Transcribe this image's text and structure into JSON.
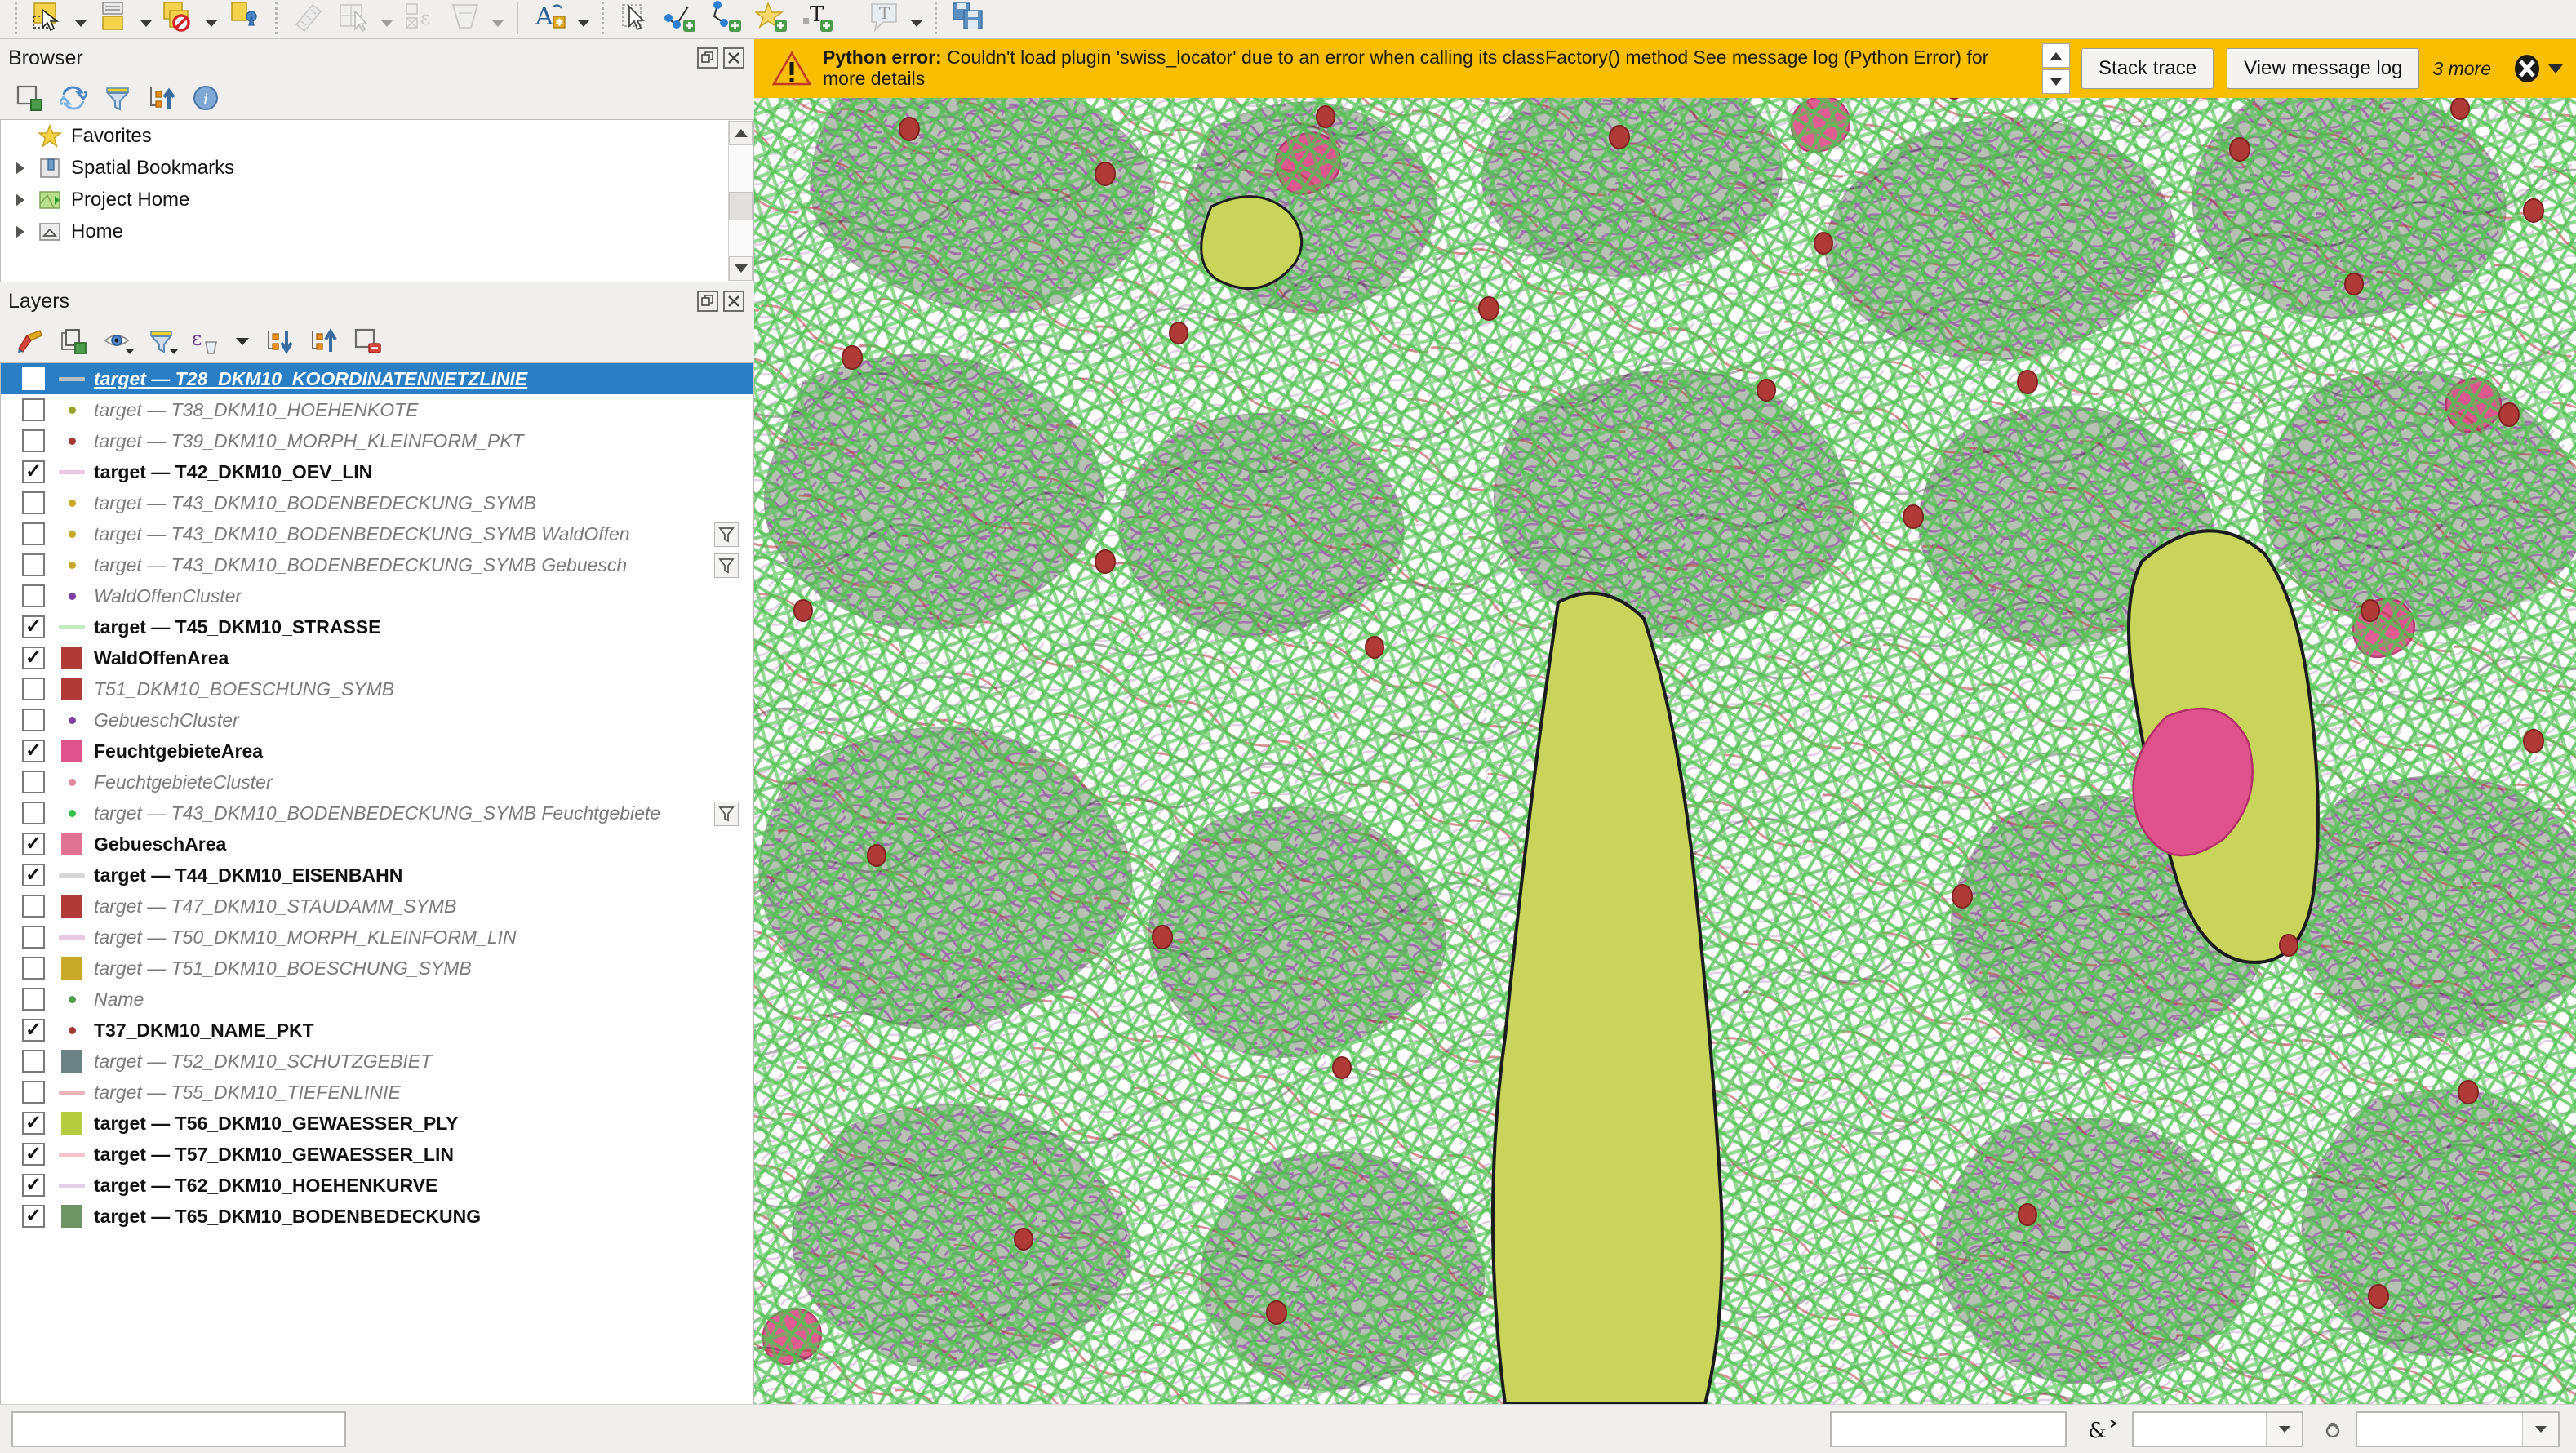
{
  "toolbar": {
    "items": [
      {
        "name": "select-features-tool",
        "icon": "select-rect-icon"
      },
      {
        "name": "select-features-dropdown",
        "icon": "chevron-down-icon"
      },
      {
        "name": "deselect-features-tool",
        "icon": "deselect-icon"
      },
      {
        "name": "deselect-dropdown",
        "icon": "chevron-down-icon"
      },
      {
        "name": "select-by-value-tool",
        "icon": "select-value-icon"
      },
      {
        "name": "select-by-value-dropdown",
        "icon": "chevron-down-icon"
      },
      {
        "name": "select-by-location-tool",
        "icon": "select-location-icon"
      },
      {
        "name": "measure-line-tool",
        "icon": "measure-line-icon"
      },
      {
        "name": "measure-area-tool",
        "icon": "measure-area-icon"
      },
      {
        "name": "measure-dropdown",
        "icon": "chevron-down-icon"
      },
      {
        "name": "statistical-summary-tool",
        "icon": "statistics-icon"
      },
      {
        "name": "map-tips-tool",
        "icon": "map-tips-icon"
      },
      {
        "name": "map-tips-dropdown",
        "icon": "chevron-down-icon"
      },
      {
        "name": "text-annotation-tool",
        "icon": "text-annotation-icon"
      },
      {
        "name": "text-annotation-dropdown",
        "icon": "chevron-down-icon"
      },
      {
        "name": "pan-map-tool",
        "icon": "pan-hand-icon"
      },
      {
        "name": "edit-vertex-tool",
        "icon": "vertex-tool-icon"
      },
      {
        "name": "add-line-feature-tool",
        "icon": "add-line-icon"
      },
      {
        "name": "add-point-feature-tool",
        "icon": "add-point-icon"
      },
      {
        "name": "add-polygon-feature-tool",
        "icon": "add-polygon-icon"
      },
      {
        "name": "add-label-tool",
        "icon": "add-label-icon"
      },
      {
        "name": "label-toolbar-tool",
        "icon": "label-balloon-icon"
      },
      {
        "name": "label-toolbar-dropdown",
        "icon": "chevron-down-icon"
      },
      {
        "name": "save-layer-edits-tool",
        "icon": "save-layer-icon"
      }
    ]
  },
  "browser": {
    "title": "Browser",
    "tools": [
      {
        "name": "add-selected-layers-button",
        "icon": "add-layer-icon"
      },
      {
        "name": "refresh-button",
        "icon": "refresh-icon"
      },
      {
        "name": "filter-browser-button",
        "icon": "filter-icon"
      },
      {
        "name": "collapse-all-button",
        "icon": "collapse-all-icon"
      },
      {
        "name": "enable-properties-widget-button",
        "icon": "info-icon"
      }
    ],
    "panel_buttons": [
      {
        "name": "undock-browser-button",
        "icon": "float-icon"
      },
      {
        "name": "close-browser-button",
        "icon": "close-icon"
      }
    ],
    "tree": [
      {
        "label": "Favorites",
        "icon": "star-icon",
        "expandable": false
      },
      {
        "label": "Spatial Bookmarks",
        "icon": "bookmarks-icon",
        "expandable": true
      },
      {
        "label": "Project Home",
        "icon": "project-home-icon",
        "expandable": true
      },
      {
        "label": "Home",
        "icon": "home-icon",
        "expandable": true
      }
    ]
  },
  "layers": {
    "title": "Layers",
    "panel_buttons": [
      {
        "name": "undock-layers-button",
        "icon": "float-icon"
      },
      {
        "name": "close-layers-button",
        "icon": "close-icon"
      }
    ],
    "tools": [
      {
        "name": "open-layer-styling-panel-button",
        "icon": "paintbrush-icon"
      },
      {
        "name": "add-group-button",
        "icon": "add-group-icon"
      },
      {
        "name": "manage-map-themes-button",
        "icon": "eye-icon",
        "has_dropdown": true
      },
      {
        "name": "filter-legend-button",
        "icon": "filter-icon",
        "has_dropdown": true
      },
      {
        "name": "filter-legend-by-expression-button",
        "icon": "expression-filter-icon"
      },
      {
        "name": "filter-legend-expression-dropdown",
        "icon": "chevron-down-icon"
      },
      {
        "name": "expand-all-button",
        "icon": "expand-all-icon"
      },
      {
        "name": "collapse-all-button",
        "icon": "collapse-all-icon"
      },
      {
        "name": "remove-layer-group-button",
        "icon": "remove-layer-icon"
      }
    ],
    "items": [
      {
        "label": "target — T28_DKM10_KOORDINATENNETZLINIE",
        "checked": false,
        "selected": true,
        "symbol": {
          "type": "line",
          "color": "#b9bcc0"
        },
        "filtered": false
      },
      {
        "label": "target — T38_DKM10_HOEHENKOTE",
        "checked": false,
        "selected": false,
        "symbol": {
          "type": "dot",
          "color": "#9aa32a"
        },
        "filtered": false
      },
      {
        "label": "target — T39_DKM10_MORPH_KLEINFORM_PKT",
        "checked": false,
        "selected": false,
        "symbol": {
          "type": "dot",
          "color": "#a23a33"
        },
        "filtered": false
      },
      {
        "label": "target — T42_DKM10_OEV_LIN",
        "checked": true,
        "selected": false,
        "symbol": {
          "type": "line",
          "color": "#e8c8e2"
        },
        "filtered": false
      },
      {
        "label": "target — T43_DKM10_BODENBEDECKUNG_SYMB",
        "checked": false,
        "selected": false,
        "symbol": {
          "type": "dot",
          "color": "#c8a825"
        },
        "filtered": false
      },
      {
        "label": "target — T43_DKM10_BODENBEDECKUNG_SYMB WaldOffen",
        "checked": false,
        "selected": false,
        "symbol": {
          "type": "dot",
          "color": "#c8a825"
        },
        "filtered": true
      },
      {
        "label": "target — T43_DKM10_BODENBEDECKUNG_SYMB Gebuesch",
        "checked": false,
        "selected": false,
        "symbol": {
          "type": "dot",
          "color": "#c8a825"
        },
        "filtered": true
      },
      {
        "label": "WaldOffenCluster",
        "checked": false,
        "selected": false,
        "symbol": {
          "type": "dot",
          "color": "#7b3fa0"
        },
        "filtered": false
      },
      {
        "label": "target — T45_DKM10_STRASSE",
        "checked": true,
        "selected": false,
        "symbol": {
          "type": "line",
          "color": "#c4ecc0"
        },
        "filtered": false
      },
      {
        "label": "WaldOffenArea",
        "checked": true,
        "selected": false,
        "symbol": {
          "type": "box",
          "color": "#b03a37"
        },
        "filtered": false
      },
      {
        "label": "T51_DKM10_BOESCHUNG_SYMB",
        "checked": false,
        "selected": false,
        "symbol": {
          "type": "box",
          "color": "#b03a37"
        },
        "filtered": false
      },
      {
        "label": "GebueschCluster",
        "checked": false,
        "selected": false,
        "symbol": {
          "type": "dot",
          "color": "#7b3fa0"
        },
        "filtered": false
      },
      {
        "label": "FeuchtgebieteArea",
        "checked": true,
        "selected": false,
        "symbol": {
          "type": "box",
          "color": "#e0528c"
        },
        "filtered": false
      },
      {
        "label": "FeuchtgebieteCluster",
        "checked": false,
        "selected": false,
        "symbol": {
          "type": "dot",
          "color": "#e0879f"
        },
        "filtered": false
      },
      {
        "label": "target — T43_DKM10_BODENBEDECKUNG_SYMB Feuchtgebiete",
        "checked": false,
        "selected": false,
        "symbol": {
          "type": "dot",
          "color": "#34bf49"
        },
        "filtered": true
      },
      {
        "label": "GebueschArea",
        "checked": true,
        "selected": false,
        "symbol": {
          "type": "box",
          "color": "#e07394"
        },
        "filtered": false
      },
      {
        "label": "target — T44_DKM10_EISENBAHN",
        "checked": true,
        "selected": false,
        "symbol": {
          "type": "line",
          "color": "#d8d8d8"
        },
        "filtered": false
      },
      {
        "label": "target — T47_DKM10_STAUDAMM_SYMB",
        "checked": false,
        "selected": false,
        "symbol": {
          "type": "box",
          "color": "#b03a37"
        },
        "filtered": false
      },
      {
        "label": "target — T50_DKM10_MORPH_KLEINFORM_LIN",
        "checked": false,
        "selected": false,
        "symbol": {
          "type": "line",
          "color": "#e8c8e2"
        },
        "filtered": false
      },
      {
        "label": "target — T51_DKM10_BOESCHUNG_SYMB",
        "checked": false,
        "selected": false,
        "symbol": {
          "type": "box",
          "color": "#c8aa28"
        },
        "filtered": false
      },
      {
        "label": "Name",
        "checked": false,
        "selected": false,
        "symbol": {
          "type": "dot",
          "color": "#4f9e4f"
        },
        "filtered": false
      },
      {
        "label": "T37_DKM10_NAME_PKT",
        "checked": true,
        "selected": false,
        "symbol": {
          "type": "dot",
          "color": "#a23a33"
        },
        "filtered": false
      },
      {
        "label": "target — T52_DKM10_SCHUTZGEBIET",
        "checked": false,
        "selected": false,
        "symbol": {
          "type": "box",
          "color": "#6d8285"
        },
        "filtered": false
      },
      {
        "label": "target — T55_DKM10_TIEFENLINIE",
        "checked": false,
        "selected": false,
        "symbol": {
          "type": "line",
          "color": "#f0b4bc"
        },
        "filtered": false
      },
      {
        "label": "target — T56_DKM10_GEWAESSER_PLY",
        "checked": true,
        "selected": false,
        "symbol": {
          "type": "box",
          "color": "#b6cc3f"
        },
        "filtered": false
      },
      {
        "label": "target — T57_DKM10_GEWAESSER_LIN",
        "checked": true,
        "selected": false,
        "symbol": {
          "type": "line",
          "color": "#f4c3cb"
        },
        "filtered": false
      },
      {
        "label": "target — T62_DKM10_HOEHENKURVE",
        "checked": true,
        "selected": false,
        "symbol": {
          "type": "line",
          "color": "#e2cfe8"
        },
        "filtered": false
      },
      {
        "label": "target — T65_DKM10_BODENBEDECKUNG",
        "checked": true,
        "selected": false,
        "symbol": {
          "type": "box",
          "color": "#6d9464"
        },
        "filtered": false
      }
    ]
  },
  "message_bar": {
    "severity": "warning",
    "title": "Python error:",
    "text": "Couldn't load plugin 'swiss_locator' due to an error when calling its classFactory() method See message log (Python Error) for more details",
    "stack_trace_label": "Stack trace",
    "view_log_label": "View message log",
    "more_label": "3 more",
    "background_color": "#f9be00"
  },
  "status_bar": {
    "locator_placeholder": "",
    "coordinate_value": "",
    "scale_value": ""
  },
  "map": {
    "name": "map-canvas",
    "colors": {
      "road_green": "#4fc14f",
      "contour_purple": "#9b62a8",
      "water_olive": "#c8d45a",
      "forest_grey_green": "#8a9b86",
      "point_red": "#b03a37",
      "wetland_pink": "#e0528c",
      "background": "#ffffff"
    }
  }
}
